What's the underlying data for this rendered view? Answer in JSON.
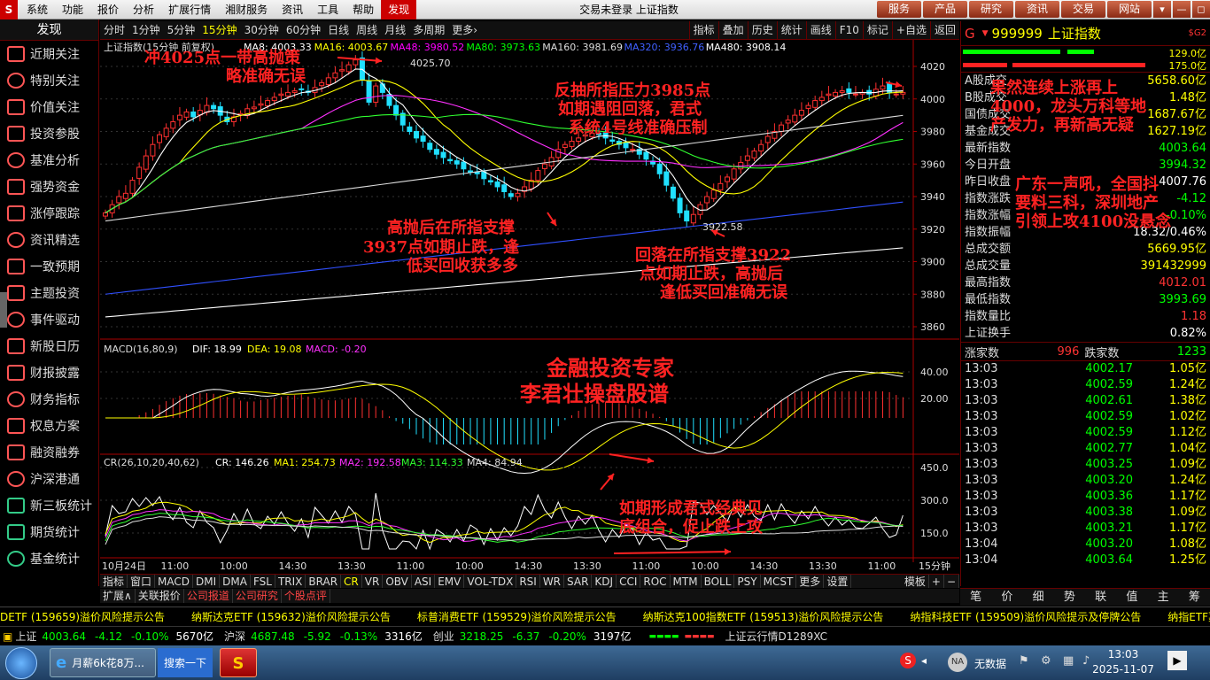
{
  "menubar": {
    "logo": "S",
    "items": [
      "系统",
      "功能",
      "报价",
      "分析",
      "扩展行情",
      "湘财服务",
      "资讯",
      "工具",
      "帮助",
      "发现"
    ],
    "highlight_index": 9,
    "title": "交易未登录 上证指数",
    "quick": [
      "服务",
      "产品",
      "研究",
      "资讯",
      "交易",
      "网站"
    ],
    "winctl": [
      "▾",
      "—",
      "◻",
      "✕"
    ]
  },
  "sidebar": {
    "header": "发现",
    "items": [
      {
        "label": "近期关注",
        "icon": "trend-icon"
      },
      {
        "label": "特别关注",
        "icon": "target-icon"
      },
      {
        "label": "价值关注",
        "icon": "piggy-icon"
      },
      {
        "label": "投资参股",
        "icon": "person-icon"
      },
      {
        "label": "基准分析",
        "icon": "bars-icon"
      },
      {
        "label": "强势资金",
        "icon": "coin-icon"
      },
      {
        "label": "涨停跟踪",
        "icon": "gauge-icon"
      },
      {
        "label": "资讯精选",
        "icon": "bulb-icon"
      },
      {
        "label": "一致预期",
        "icon": "chart-icon"
      },
      {
        "label": "主题投资",
        "icon": "globe-icon"
      },
      {
        "label": "事件驱动",
        "icon": "gear-icon"
      },
      {
        "label": "新股日历",
        "icon": "people-icon"
      },
      {
        "label": "财报披露",
        "icon": "doc-icon"
      },
      {
        "label": "财务指标",
        "icon": "calc-icon"
      },
      {
        "label": "权息方案",
        "icon": "case-icon"
      },
      {
        "label": "融资融券",
        "icon": "bank-icon"
      },
      {
        "label": "沪深港通",
        "icon": "link-icon"
      },
      {
        "label": "新三板统计",
        "icon": "sheet-icon"
      },
      {
        "label": "期货统计",
        "icon": "bag-icon"
      },
      {
        "label": "基金统计",
        "icon": "fund-icon"
      }
    ]
  },
  "periods": {
    "items": [
      "分时",
      "1分钟",
      "5分钟",
      "15分钟",
      "30分钟",
      "60分钟",
      "日线",
      "周线",
      "月线",
      "多周期",
      "更多›"
    ],
    "active": "15分钟",
    "right": [
      "指标",
      "叠加",
      "历史",
      "统计",
      "画线",
      "F10",
      "标记",
      "+自选",
      "返回"
    ]
  },
  "chart": {
    "title": "上证指数(15分钟 前复权)",
    "ma": [
      {
        "label": "MA8: 4003.33",
        "color": "#ffffff"
      },
      {
        "label": "MA16: 4003.67",
        "color": "#ffff00"
      },
      {
        "label": "MA48: 3980.52",
        "color": "#ff00ff"
      },
      {
        "label": "MA80: 3973.63",
        "color": "#00ff00"
      },
      {
        "label": "MA160: 3981.69",
        "color": "#dddddd"
      },
      {
        "label": "MA320: 3936.76",
        "color": "#4060ff"
      },
      {
        "label": "MA480: 3908.14",
        "color": "#ffffff"
      }
    ],
    "price_ticks": [
      "4020",
      "4000",
      "3980",
      "3960",
      "3940",
      "3920",
      "3900",
      "3880",
      "3860"
    ],
    "high_label": "4025.70",
    "low_label": "3922.58",
    "macd": {
      "title": "MACD(16,80,9)",
      "dif": "DIF: 18.99",
      "dea": "DEA: 19.08",
      "macd": "MACD: -0.20",
      "ticks": [
        "40.00",
        "20.00"
      ]
    },
    "cr": {
      "title": "CR(26,10,20,40,62)",
      "cr": "CR: 146.26",
      "ma1": "MA1: 254.73",
      "ma2": "MA2: 192.58",
      "ma3": "MA3: 114.33",
      "ma4": "MA4: 84.94",
      "ticks": [
        "450.0",
        "300.0",
        "150.0"
      ]
    },
    "xlabels": [
      "10月24日",
      "11:00",
      "10:00",
      "14:30",
      "13:30",
      "11:00",
      "10:00",
      "14:30",
      "13:30",
      "11:00",
      "10:00",
      "14:30",
      "13:30",
      "11:00"
    ],
    "xunit": "15分钟",
    "annotations": {
      "a1": "冲4025点一带高抛策",
      "a2": "略准确无误",
      "b1": "反抽所指压力3985点",
      "b2": "如期遇阻回落，君式",
      "b3": "系统4号线准确压制",
      "c1": "高抛后在所指支撑",
      "c2": "3937点如期止跌，逢",
      "c3": "低买回收获多多",
      "d1": "回落在所指支撑3922",
      "d2": "点如期止跌，高抛后",
      "d3": "逢低买回准确无误",
      "e1": "金融投资专家",
      "e2": "李君壮操盘股谱",
      "f1": "如期形成君式经典见",
      "f2": "底组合，促止跌上攻",
      "g1": "果然连续上涨再上",
      "g2": "4000，龙头万科等地",
      "g3": "产发力，再新高无疑",
      "h1": "广东一声吼，全国抖",
      "h2": "要料三科，深圳地产",
      "h3": "引领上攻4100没悬念"
    }
  },
  "tabs1": [
    "指标",
    "窗口",
    "MACD",
    "DMI",
    "DMA",
    "FSL",
    "TRIX",
    "BRAR",
    "CR",
    "VR",
    "OBV",
    "ASI",
    "EMV",
    "VOL-TDX",
    "RSI",
    "WR",
    "SAR",
    "KDJ",
    "CCI",
    "ROC",
    "MTM",
    "BOLL",
    "PSY",
    "MCST",
    "更多",
    "设置"
  ],
  "tabs1_right": [
    "模板",
    "+",
    "−"
  ],
  "tabs2": [
    "扩展∧",
    "关联报价",
    "公司报道",
    "公司研究",
    "个股点评"
  ],
  "right": {
    "code": "999999",
    "name": "上证指数",
    "sg": "$G2",
    "bar_vals": [
      "129.0亿",
      "175.0亿"
    ],
    "rows": [
      {
        "l": "A股成交",
        "v": "5658.60亿",
        "c": "#ffff00"
      },
      {
        "l": "B股成交",
        "v": "1.48亿",
        "c": "#ffff00"
      },
      {
        "l": "国债成交",
        "v": "1687.67亿",
        "c": "#ffff00"
      },
      {
        "l": "基金成交",
        "v": "1627.19亿",
        "c": "#ffff00"
      },
      {
        "l": "最新指数",
        "v": "4003.64",
        "c": "#00ff00"
      },
      {
        "l": "今日开盘",
        "v": "3994.32",
        "c": "#00ff00"
      },
      {
        "l": "昨日收盘",
        "v": "4007.76",
        "c": "#ffffff"
      },
      {
        "l": "指数涨跌",
        "v": "-4.12",
        "c": "#00ff00"
      },
      {
        "l": "指数涨幅",
        "v": "-0.10%",
        "c": "#00ff00"
      },
      {
        "l": "指数振幅",
        "v": "18.32/0.46%",
        "c": "#ffffff"
      },
      {
        "l": "总成交额",
        "v": "5669.95亿",
        "c": "#ffff00"
      },
      {
        "l": "总成交量",
        "v": "391432999",
        "c": "#ffff00"
      },
      {
        "l": "最高指数",
        "v": "4012.01",
        "c": "#ff3333"
      },
      {
        "l": "最低指数",
        "v": "3993.69",
        "c": "#00ff00"
      },
      {
        "l": "指数量比",
        "v": "1.18",
        "c": "#ff3333"
      },
      {
        "l": "上证换手",
        "v": "0.82%",
        "c": "#ffffff"
      }
    ],
    "updown": {
      "up_label": "涨家数",
      "up": "996",
      "down_label": "跌家数",
      "down": "1233"
    },
    "ticks": [
      {
        "t": "13:03",
        "p": "4002.17",
        "v": "1.05亿"
      },
      {
        "t": "13:03",
        "p": "4002.59",
        "v": "1.24亿"
      },
      {
        "t": "13:03",
        "p": "4002.61",
        "v": "1.38亿"
      },
      {
        "t": "13:03",
        "p": "4002.59",
        "v": "1.02亿"
      },
      {
        "t": "13:03",
        "p": "4002.59",
        "v": "1.12亿"
      },
      {
        "t": "13:03",
        "p": "4002.77",
        "v": "1.04亿"
      },
      {
        "t": "13:03",
        "p": "4003.25",
        "v": "1.09亿"
      },
      {
        "t": "13:03",
        "p": "4003.20",
        "v": "1.24亿"
      },
      {
        "t": "13:03",
        "p": "4003.36",
        "v": "1.17亿"
      },
      {
        "t": "13:03",
        "p": "4003.38",
        "v": "1.09亿"
      },
      {
        "t": "13:03",
        "p": "4003.21",
        "v": "1.17亿"
      },
      {
        "t": "13:04",
        "p": "4003.20",
        "v": "1.08亿"
      },
      {
        "t": "13:04",
        "p": "4003.64",
        "v": "1.25亿"
      }
    ],
    "btm": [
      "笔",
      "价",
      "细",
      "势",
      "联",
      "值",
      "主",
      "筹"
    ]
  },
  "ticker": [
    "DETF (159659)溢价风险提示公告",
    "纳斯达克ETF (159632)溢价风险提示公告",
    "标普消费ETF (159529)溢价风险提示公告",
    "纳斯达克100指数ETF (159513)溢价风险提示公告",
    "纳指科技ETF (159509)溢价风险提示及停牌公告",
    "纳指ETF嘉实 (15"
  ],
  "status": {
    "sh_label": "上证",
    "sh": "4003.64",
    "sh_chg": "-4.12",
    "sh_pct": "-0.10%",
    "sh_amt": "5670亿",
    "hs_label": "沪深",
    "hs": "4687.48",
    "hs_chg": "-5.92",
    "hs_pct": "-0.13%",
    "hs_amt": "3316亿",
    "cy_label": "创业",
    "cy": "3218.25",
    "cy_chg": "-6.37",
    "cy_pct": "-0.20%",
    "cy_amt": "3197亿",
    "cloud": "上证云行情D1289XC"
  },
  "taskbar": {
    "ie_label": "月薪6k花8万...",
    "search": "搜索一下",
    "nodata": "无数据",
    "time": "13:03",
    "date": "2025-11-07"
  }
}
